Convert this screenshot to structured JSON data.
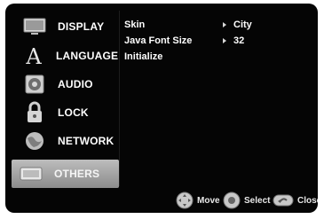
{
  "menu": {
    "items": [
      {
        "label": "DISPLAY",
        "icon": "display-icon"
      },
      {
        "label": "LANGUAGE",
        "icon": "language-icon"
      },
      {
        "label": "AUDIO",
        "icon": "audio-icon"
      },
      {
        "label": "LOCK",
        "icon": "lock-icon"
      },
      {
        "label": "NETWORK",
        "icon": "network-icon"
      },
      {
        "label": "OTHERS",
        "icon": "others-icon"
      }
    ],
    "selected": "OTHERS"
  },
  "options": [
    {
      "label": "Skin",
      "value": "City"
    },
    {
      "label": "Java Font Size",
      "value": "32"
    },
    {
      "label": "Initialize",
      "value": ""
    }
  ],
  "footer": {
    "move_label": "Move",
    "select_label": "Select",
    "close_label": "Close"
  },
  "colors": {
    "background": "#050505",
    "selected_bg": "#a6a6a6",
    "text": "#ffffff"
  }
}
